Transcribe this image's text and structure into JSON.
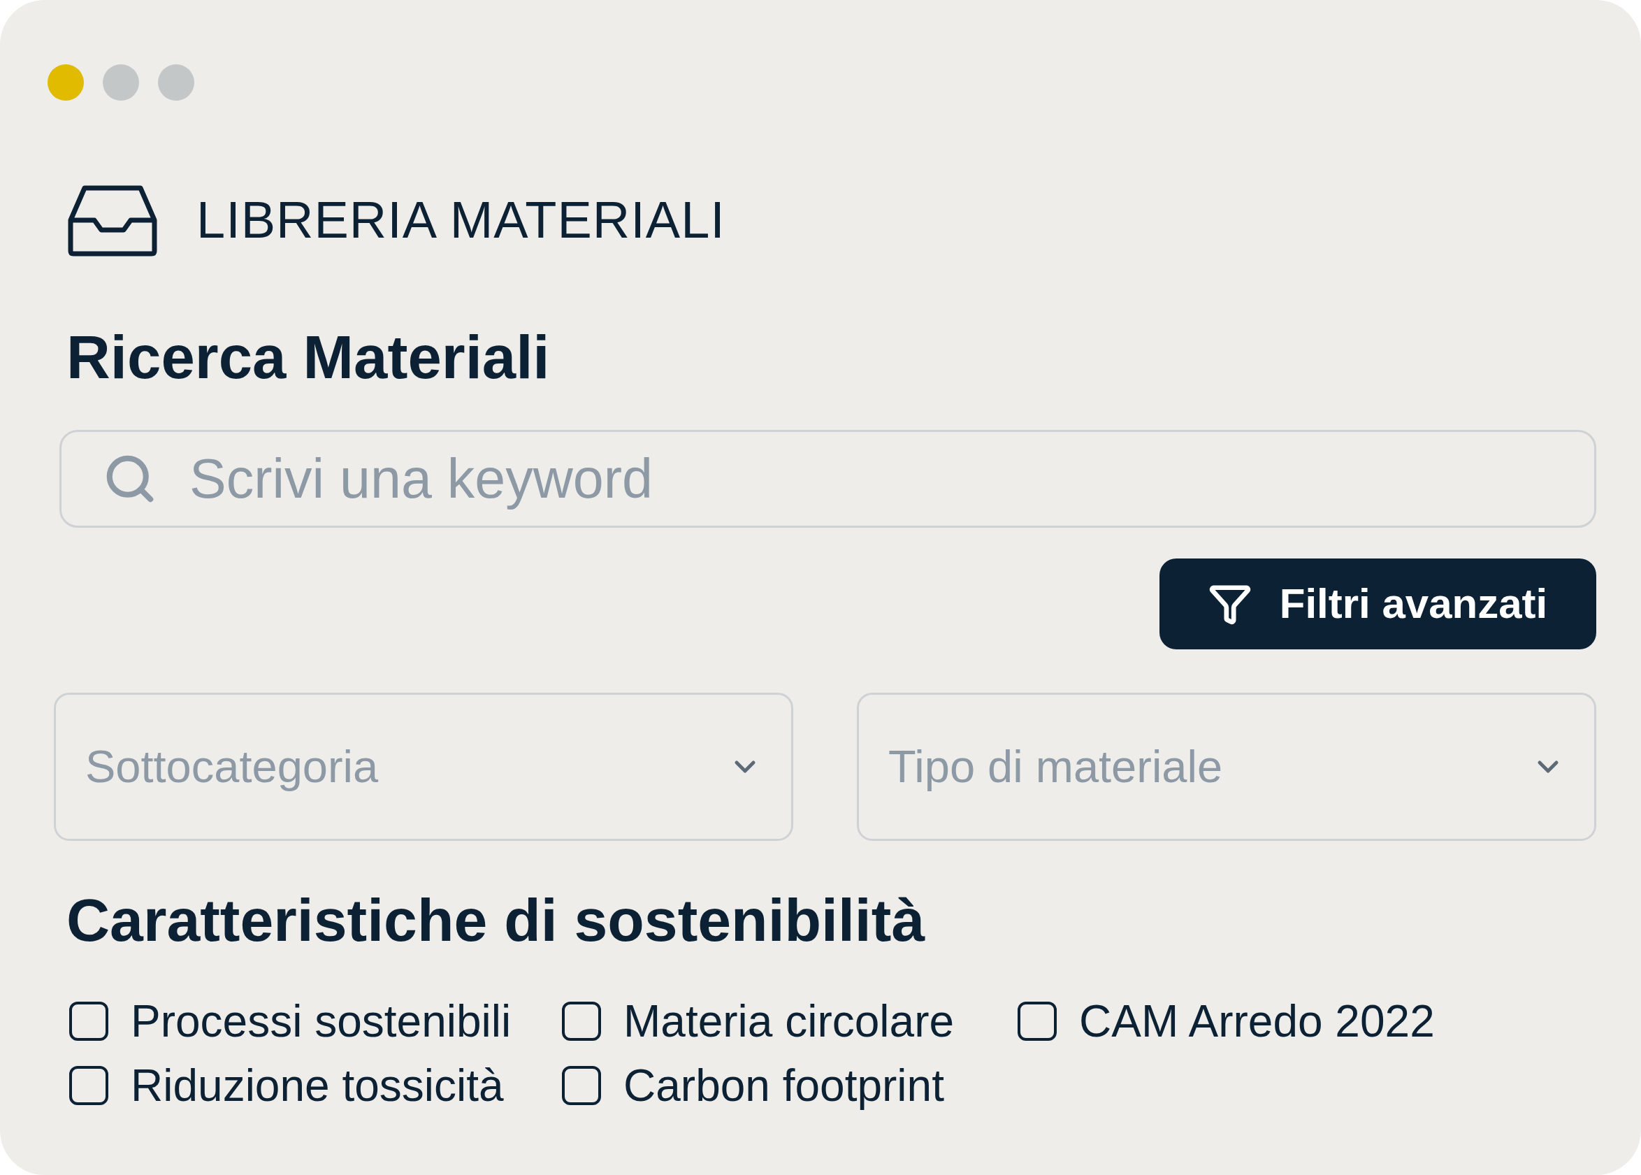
{
  "window": {
    "controls": [
      {
        "color": "#e0bb00"
      },
      {
        "color": "#c4c7c8"
      },
      {
        "color": "#c4c7c8"
      }
    ]
  },
  "header": {
    "title": "LIBRERIA MATERIALI"
  },
  "search": {
    "title": "Ricerca Materiali",
    "placeholder": "Scrivi una keyword"
  },
  "advanced_filters_button": "Filtri avanzati",
  "dropdowns": [
    {
      "placeholder": "Sottocategoria"
    },
    {
      "placeholder": "Tipo di materiale"
    }
  ],
  "sustainability": {
    "title": "Caratteristiche di sostenibilità",
    "options": [
      {
        "label": "Processi sostenibili",
        "checked": false
      },
      {
        "label": "Materia circolare",
        "checked": false
      },
      {
        "label": "CAM Arredo 2022",
        "checked": false
      },
      {
        "label": "Riduzione tossicità",
        "checked": false
      },
      {
        "label": "Carbon footprint",
        "checked": false
      }
    ]
  }
}
